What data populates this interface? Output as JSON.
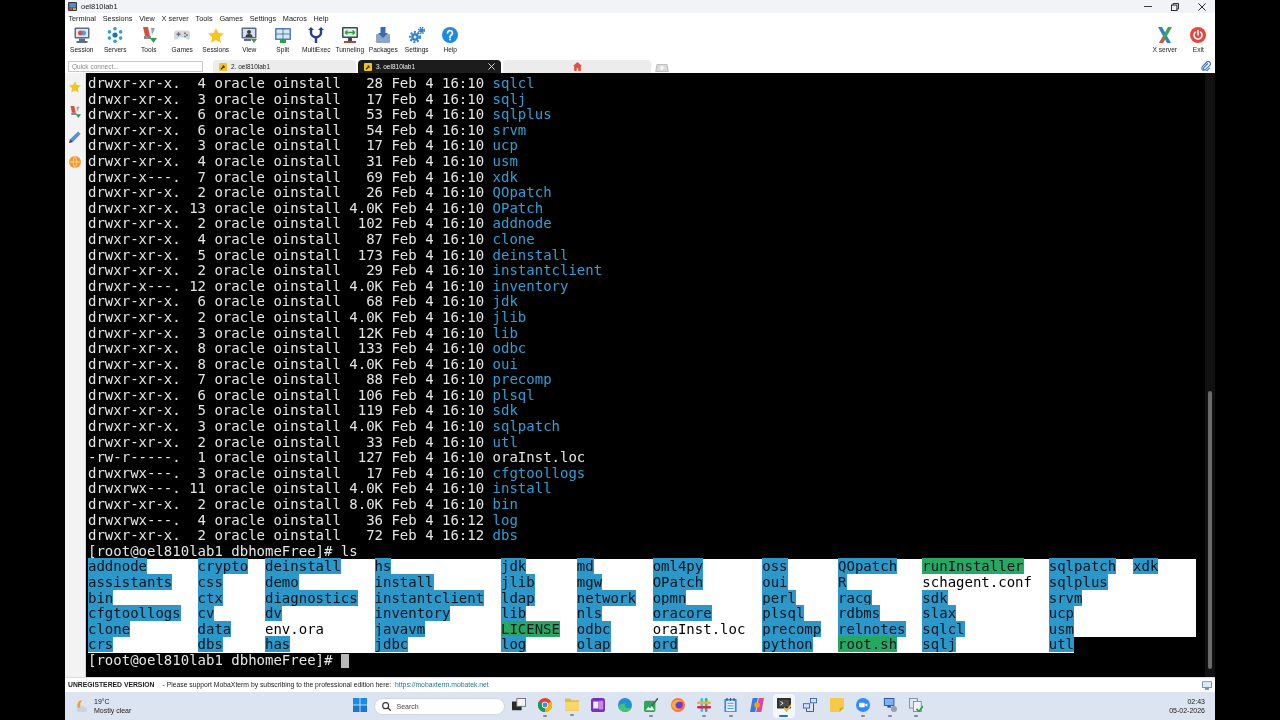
{
  "window": {
    "title": "oel810lab1"
  },
  "menu": [
    "Terminal",
    "Sessions",
    "View",
    "X server",
    "Tools",
    "Games",
    "Settings",
    "Macros",
    "Help"
  ],
  "toolbar": {
    "left": [
      {
        "label": "Session"
      },
      {
        "label": "Servers"
      },
      {
        "label": "Tools"
      },
      {
        "label": "Games"
      },
      {
        "label": "Sessions"
      },
      {
        "label": "View"
      },
      {
        "label": "Split"
      },
      {
        "label": "MultiExec"
      },
      {
        "label": "Tunneling"
      },
      {
        "label": "Packages"
      },
      {
        "label": "Settings"
      },
      {
        "label": "Help"
      }
    ],
    "right": [
      {
        "label": "X server"
      },
      {
        "label": "Exit"
      }
    ]
  },
  "quick_connect": {
    "placeholder": "Quick connect..."
  },
  "tabs": [
    {
      "label": "2. oel810lab1",
      "selected": false
    },
    {
      "label": "3. oel810lab1",
      "selected": true
    }
  ],
  "terminal": {
    "listing": [
      {
        "permissions": "drwxr-xr-x.",
        "links": "4",
        "owner": "oracle",
        "group": "oinstall",
        "size": "28",
        "month": "Feb",
        "day": "4",
        "time": "16:10",
        "name": "sqlcl",
        "kind": "directory"
      },
      {
        "permissions": "drwxr-xr-x.",
        "links": "3",
        "owner": "oracle",
        "group": "oinstall",
        "size": "17",
        "month": "Feb",
        "day": "4",
        "time": "16:10",
        "name": "sqlj",
        "kind": "directory"
      },
      {
        "permissions": "drwxr-xr-x.",
        "links": "6",
        "owner": "oracle",
        "group": "oinstall",
        "size": "53",
        "month": "Feb",
        "day": "4",
        "time": "16:10",
        "name": "sqlplus",
        "kind": "directory"
      },
      {
        "permissions": "drwxr-xr-x.",
        "links": "6",
        "owner": "oracle",
        "group": "oinstall",
        "size": "54",
        "month": "Feb",
        "day": "4",
        "time": "16:10",
        "name": "srvm",
        "kind": "directory"
      },
      {
        "permissions": "drwxr-xr-x.",
        "links": "3",
        "owner": "oracle",
        "group": "oinstall",
        "size": "17",
        "month": "Feb",
        "day": "4",
        "time": "16:10",
        "name": "ucp",
        "kind": "directory"
      },
      {
        "permissions": "drwxr-xr-x.",
        "links": "4",
        "owner": "oracle",
        "group": "oinstall",
        "size": "31",
        "month": "Feb",
        "day": "4",
        "time": "16:10",
        "name": "usm",
        "kind": "directory"
      },
      {
        "permissions": "drwxr-x---.",
        "links": "7",
        "owner": "oracle",
        "group": "oinstall",
        "size": "69",
        "month": "Feb",
        "day": "4",
        "time": "16:10",
        "name": "xdk",
        "kind": "directory"
      },
      {
        "permissions": "drwxr-xr-x.",
        "links": "2",
        "owner": "oracle",
        "group": "oinstall",
        "size": "26",
        "month": "Feb",
        "day": "4",
        "time": "16:10",
        "name": "QOpatch",
        "kind": "directory"
      },
      {
        "permissions": "drwxr-xr-x.",
        "links": "13",
        "owner": "oracle",
        "group": "oinstall",
        "size": "4.0K",
        "month": "Feb",
        "day": "4",
        "time": "16:10",
        "name": "OPatch",
        "kind": "directory"
      },
      {
        "permissions": "drwxr-xr-x.",
        "links": "2",
        "owner": "oracle",
        "group": "oinstall",
        "size": "102",
        "month": "Feb",
        "day": "4",
        "time": "16:10",
        "name": "addnode",
        "kind": "directory"
      },
      {
        "permissions": "drwxr-xr-x.",
        "links": "4",
        "owner": "oracle",
        "group": "oinstall",
        "size": "87",
        "month": "Feb",
        "day": "4",
        "time": "16:10",
        "name": "clone",
        "kind": "directory"
      },
      {
        "permissions": "drwxr-xr-x.",
        "links": "5",
        "owner": "oracle",
        "group": "oinstall",
        "size": "173",
        "month": "Feb",
        "day": "4",
        "time": "16:10",
        "name": "deinstall",
        "kind": "directory"
      },
      {
        "permissions": "drwxr-xr-x.",
        "links": "2",
        "owner": "oracle",
        "group": "oinstall",
        "size": "29",
        "month": "Feb",
        "day": "4",
        "time": "16:10",
        "name": "instantclient",
        "kind": "directory"
      },
      {
        "permissions": "drwxr-x---.",
        "links": "12",
        "owner": "oracle",
        "group": "oinstall",
        "size": "4.0K",
        "month": "Feb",
        "day": "4",
        "time": "16:10",
        "name": "inventory",
        "kind": "directory"
      },
      {
        "permissions": "drwxr-xr-x.",
        "links": "6",
        "owner": "oracle",
        "group": "oinstall",
        "size": "68",
        "month": "Feb",
        "day": "4",
        "time": "16:10",
        "name": "jdk",
        "kind": "directory"
      },
      {
        "permissions": "drwxr-xr-x.",
        "links": "2",
        "owner": "oracle",
        "group": "oinstall",
        "size": "4.0K",
        "month": "Feb",
        "day": "4",
        "time": "16:10",
        "name": "jlib",
        "kind": "directory"
      },
      {
        "permissions": "drwxr-xr-x.",
        "links": "3",
        "owner": "oracle",
        "group": "oinstall",
        "size": "12K",
        "month": "Feb",
        "day": "4",
        "time": "16:10",
        "name": "lib",
        "kind": "directory"
      },
      {
        "permissions": "drwxr-xr-x.",
        "links": "8",
        "owner": "oracle",
        "group": "oinstall",
        "size": "133",
        "month": "Feb",
        "day": "4",
        "time": "16:10",
        "name": "odbc",
        "kind": "directory"
      },
      {
        "permissions": "drwxr-xr-x.",
        "links": "8",
        "owner": "oracle",
        "group": "oinstall",
        "size": "4.0K",
        "month": "Feb",
        "day": "4",
        "time": "16:10",
        "name": "oui",
        "kind": "directory"
      },
      {
        "permissions": "drwxr-xr-x.",
        "links": "7",
        "owner": "oracle",
        "group": "oinstall",
        "size": "88",
        "month": "Feb",
        "day": "4",
        "time": "16:10",
        "name": "precomp",
        "kind": "directory"
      },
      {
        "permissions": "drwxr-xr-x.",
        "links": "6",
        "owner": "oracle",
        "group": "oinstall",
        "size": "106",
        "month": "Feb",
        "day": "4",
        "time": "16:10",
        "name": "plsql",
        "kind": "directory"
      },
      {
        "permissions": "drwxr-xr-x.",
        "links": "5",
        "owner": "oracle",
        "group": "oinstall",
        "size": "119",
        "month": "Feb",
        "day": "4",
        "time": "16:10",
        "name": "sdk",
        "kind": "directory"
      },
      {
        "permissions": "drwxr-xr-x.",
        "links": "3",
        "owner": "oracle",
        "group": "oinstall",
        "size": "4.0K",
        "month": "Feb",
        "day": "4",
        "time": "16:10",
        "name": "sqlpatch",
        "kind": "directory"
      },
      {
        "permissions": "drwxr-xr-x.",
        "links": "2",
        "owner": "oracle",
        "group": "oinstall",
        "size": "33",
        "month": "Feb",
        "day": "4",
        "time": "16:10",
        "name": "utl",
        "kind": "directory"
      },
      {
        "permissions": "-rw-r-----.",
        "links": "1",
        "owner": "oracle",
        "group": "oinstall",
        "size": "127",
        "month": "Feb",
        "day": "4",
        "time": "16:10",
        "name": "oraInst.loc",
        "kind": "file"
      },
      {
        "permissions": "drwxrwx---.",
        "links": "3",
        "owner": "oracle",
        "group": "oinstall",
        "size": "17",
        "month": "Feb",
        "day": "4",
        "time": "16:10",
        "name": "cfgtoollogs",
        "kind": "directory"
      },
      {
        "permissions": "drwxrwx---.",
        "links": "11",
        "owner": "oracle",
        "group": "oinstall",
        "size": "4.0K",
        "month": "Feb",
        "day": "4",
        "time": "16:10",
        "name": "install",
        "kind": "directory"
      },
      {
        "permissions": "drwxr-xr-x.",
        "links": "2",
        "owner": "oracle",
        "group": "oinstall",
        "size": "8.0K",
        "month": "Feb",
        "day": "4",
        "time": "16:10",
        "name": "bin",
        "kind": "directory"
      },
      {
        "permissions": "drwxrwx---.",
        "links": "4",
        "owner": "oracle",
        "group": "oinstall",
        "size": "36",
        "month": "Feb",
        "day": "4",
        "time": "16:12",
        "name": "log",
        "kind": "directory"
      },
      {
        "permissions": "drwxr-xr-x.",
        "links": "2",
        "owner": "oracle",
        "group": "oinstall",
        "size": "72",
        "month": "Feb",
        "day": "4",
        "time": "16:12",
        "name": "dbs",
        "kind": "directory"
      }
    ],
    "command_line": {
      "prompt": "[root@oel810lab1 dbhomeFree]#",
      "command": "ls"
    },
    "ls_output": {
      "selected": true,
      "columns": [
        [
          {
            "name": "addnode",
            "kind": "directory"
          },
          {
            "name": "assistants",
            "kind": "directory"
          },
          {
            "name": "bin",
            "kind": "directory"
          },
          {
            "name": "cfgtoollogs",
            "kind": "directory"
          },
          {
            "name": "clone",
            "kind": "directory"
          },
          {
            "name": "crs",
            "kind": "directory"
          }
        ],
        [
          {
            "name": "crypto",
            "kind": "directory"
          },
          {
            "name": "css",
            "kind": "directory"
          },
          {
            "name": "ctx",
            "kind": "directory"
          },
          {
            "name": "cv",
            "kind": "directory"
          },
          {
            "name": "data",
            "kind": "directory"
          },
          {
            "name": "dbs",
            "kind": "directory"
          }
        ],
        [
          {
            "name": "deinstall",
            "kind": "directory"
          },
          {
            "name": "demo",
            "kind": "directory"
          },
          {
            "name": "diagnostics",
            "kind": "directory"
          },
          {
            "name": "dv",
            "kind": "directory"
          },
          {
            "name": "env.ora",
            "kind": "file"
          },
          {
            "name": "has",
            "kind": "directory"
          }
        ],
        [
          {
            "name": "hs",
            "kind": "directory"
          },
          {
            "name": "install",
            "kind": "directory"
          },
          {
            "name": "instantclient",
            "kind": "directory"
          },
          {
            "name": "inventory",
            "kind": "directory"
          },
          {
            "name": "javavm",
            "kind": "directory"
          },
          {
            "name": "jdbc",
            "kind": "directory"
          }
        ],
        [
          {
            "name": "jdk",
            "kind": "directory"
          },
          {
            "name": "jlib",
            "kind": "directory"
          },
          {
            "name": "ldap",
            "kind": "directory"
          },
          {
            "name": "lib",
            "kind": "directory"
          },
          {
            "name": "LICENSE",
            "kind": "executable"
          },
          {
            "name": "log",
            "kind": "directory"
          }
        ],
        [
          {
            "name": "md",
            "kind": "directory"
          },
          {
            "name": "mgw",
            "kind": "directory"
          },
          {
            "name": "network",
            "kind": "directory"
          },
          {
            "name": "nls",
            "kind": "directory"
          },
          {
            "name": "odbc",
            "kind": "directory"
          },
          {
            "name": "olap",
            "kind": "directory"
          }
        ],
        [
          {
            "name": "oml4py",
            "kind": "directory"
          },
          {
            "name": "OPatch",
            "kind": "directory"
          },
          {
            "name": "opmn",
            "kind": "directory"
          },
          {
            "name": "oracore",
            "kind": "directory"
          },
          {
            "name": "oraInst.loc",
            "kind": "file"
          },
          {
            "name": "ord",
            "kind": "directory"
          }
        ],
        [
          {
            "name": "oss",
            "kind": "directory"
          },
          {
            "name": "oui",
            "kind": "directory"
          },
          {
            "name": "perl",
            "kind": "directory"
          },
          {
            "name": "plsql",
            "kind": "directory"
          },
          {
            "name": "precomp",
            "kind": "directory"
          },
          {
            "name": "python",
            "kind": "directory"
          }
        ],
        [
          {
            "name": "QOpatch",
            "kind": "directory"
          },
          {
            "name": "R",
            "kind": "directory"
          },
          {
            "name": "racg",
            "kind": "directory"
          },
          {
            "name": "rdbms",
            "kind": "directory"
          },
          {
            "name": "relnotes",
            "kind": "directory"
          },
          {
            "name": "root.sh",
            "kind": "executable"
          }
        ],
        [
          {
            "name": "runInstaller",
            "kind": "executable"
          },
          {
            "name": "schagent.conf",
            "kind": "file"
          },
          {
            "name": "sdk",
            "kind": "directory"
          },
          {
            "name": "slax",
            "kind": "directory"
          },
          {
            "name": "sqlcl",
            "kind": "directory"
          },
          {
            "name": "sqlj",
            "kind": "directory"
          }
        ],
        [
          {
            "name": "sqlpatch",
            "kind": "directory"
          },
          {
            "name": "sqlplus",
            "kind": "directory"
          },
          {
            "name": "srvm",
            "kind": "directory"
          },
          {
            "name": "ucp",
            "kind": "directory"
          },
          {
            "name": "usm",
            "kind": "directory"
          },
          {
            "name": "utl",
            "kind": "directory"
          }
        ],
        [
          {
            "name": "xdk",
            "kind": "directory"
          }
        ]
      ]
    },
    "current_prompt": {
      "prompt": "[root@oel810lab1 dbhomeFree]#"
    }
  },
  "status_bar": {
    "notice": "UNREGISTERED VERSION",
    "message": "- Please support MobaXterm by subscribing to the professional edition here:",
    "link": "https://mobaxterm.mobatek.net"
  },
  "taskbar": {
    "weather": {
      "temperature": "19°C",
      "condition": "Mostly clear"
    },
    "search": {
      "placeholder": "Search"
    },
    "apps": [
      {
        "running": false,
        "active": false
      },
      {
        "running": true,
        "active": false
      },
      {
        "running": true,
        "active": false
      },
      {
        "running": false,
        "active": false
      },
      {
        "running": false,
        "active": false
      },
      {
        "running": true,
        "active": false
      },
      {
        "running": false,
        "active": false
      },
      {
        "running": true,
        "active": false
      },
      {
        "running": true,
        "active": false
      },
      {
        "running": false,
        "active": false
      },
      {
        "running": true,
        "active": true
      },
      {
        "running": false,
        "active": false
      },
      {
        "running": false,
        "active": false
      },
      {
        "running": true,
        "active": false
      },
      {
        "running": true,
        "active": false
      },
      {
        "running": true,
        "active": false
      }
    ],
    "clock": {
      "time": "02:43",
      "date": "05-02-2026"
    }
  }
}
